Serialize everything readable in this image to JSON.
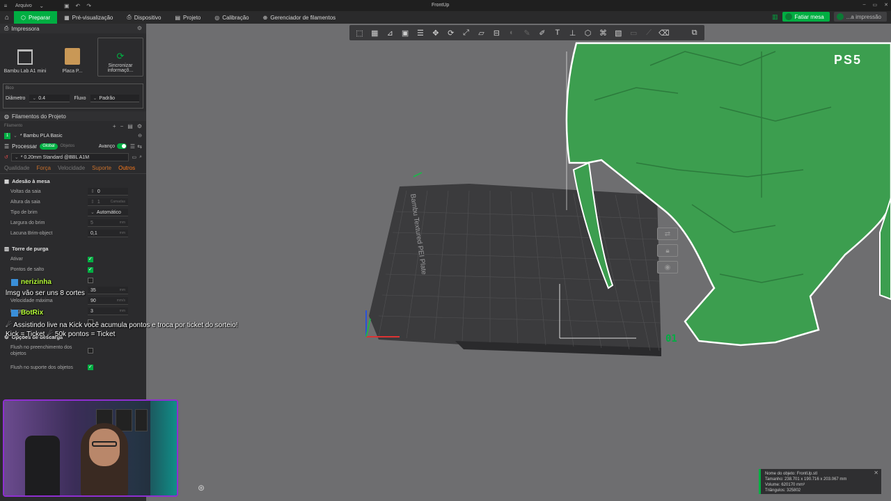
{
  "titlebar": {
    "menu_label": "Arquivo",
    "app_title": "FrontUp"
  },
  "nav": {
    "tabs": [
      {
        "label": "Preparar",
        "icon": "cube-icon",
        "active": true
      },
      {
        "label": "Pré-visualização",
        "icon": "preview-icon",
        "active": false
      },
      {
        "label": "Dispositivo",
        "icon": "device-icon",
        "active": false
      },
      {
        "label": "Projeto",
        "icon": "project-icon",
        "active": false
      },
      {
        "label": "Calibração",
        "icon": "calibration-icon",
        "active": false
      },
      {
        "label": "Gerenciador de filamentos",
        "icon": "filament-icon",
        "active": false
      }
    ],
    "slice_label": "Fatiar mesa",
    "print_label": "...a impressão"
  },
  "sidebar": {
    "printer_title": "Impressora",
    "printer_name": "Bambu Lab A1 mini",
    "plate_name": "Placa P...",
    "sync_label": "Sincronizar informaçõ...",
    "nozzle_label": "Bico",
    "diameter_label": "Diâmetro",
    "diameter_value": "0.4",
    "flow_label": "Fluxo",
    "flow_value": "Padrão",
    "filaments_title": "Filamentos do Projeto",
    "filament_sub": "Filamento",
    "filament_num": "1",
    "filament_name": "* Bambu PLA Basic",
    "process_label": "Processar",
    "global_label": "Global",
    "objects_label": "Objetos",
    "advanced_label": "Avanço",
    "preset_name": "* 0.20mm Standard @BBL A1M",
    "tabs": [
      "Qualidade",
      "Força",
      "Velocidade",
      "Suporte",
      "Outros"
    ],
    "active_tab": "Outros",
    "bed_adhesion_title": "Adesão à mesa",
    "skirt_loops_label": "Voltas da saia",
    "skirt_loops_value": "0",
    "skirt_height_label": "Altura da saia",
    "skirt_height_value": "1",
    "skirt_height_unit": "Camadas",
    "brim_type_label": "Tipo de brim",
    "brim_type_value": "Automático",
    "brim_width_label": "Largura do brim",
    "brim_width_value": "5",
    "brim_gap_label": "Lacuna Brim-object",
    "brim_gap_value": "0,1",
    "unit_mm": "mm",
    "prime_tower_title": "Torre de purga",
    "enable_label": "Ativar",
    "skip_points_label": "Pontos de salto",
    "speed_value": "35",
    "max_speed_label": "Velocidade máxima",
    "max_speed_value": "90",
    "max_speed_unit": "mm/s",
    "width_label": "Largura",
    "width_value": "3",
    "flush_title": "Opções de descarga",
    "flush_infill_label": "Flush no preenchimento dos objetos",
    "flush_support_label": "Flush no suporte dos objetos"
  },
  "viewport": {
    "plate_label": "Bambu Textured PEI Plate",
    "plate_number": "01",
    "ps5_label": "PS5",
    "object_info": {
      "name": "Nome do objeto: FrontUp.stl",
      "size": "Tamanho: 238.701 x 190.716 x 203.067 mm",
      "volume": "Volume: 620170 mm³",
      "triangles": "Triângulos: 325802"
    }
  },
  "chat": {
    "user1": "nerizinha",
    "msg1": "lmsg vão ser uns 8 cortes",
    "user2": "BotRix",
    "msg2a": "☄ Assistindo live na Kick você acumula pontos e troca por ticket do sorteio!",
    "msg2b": "Kick = Ticket ☄ 50k pontos = Ticket"
  },
  "colors": {
    "accent": "#00ae42",
    "model": "#3c9e4f",
    "active_tab": "#ff7a1a",
    "webcam_border": "#8f2fd1"
  }
}
